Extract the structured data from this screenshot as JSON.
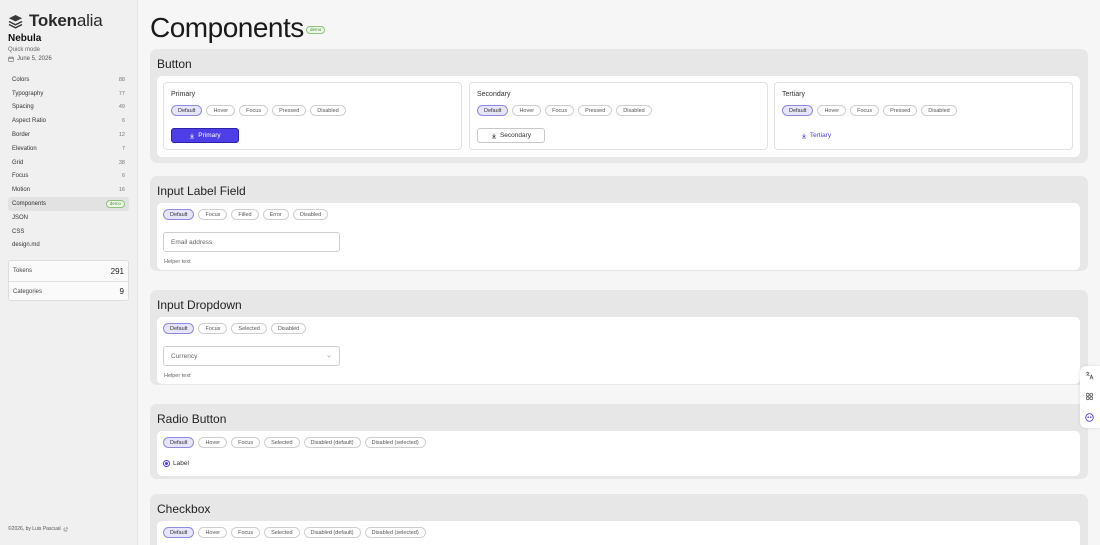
{
  "app": {
    "logo_bold": "Token",
    "logo_rest": "alia",
    "project": "Nebula",
    "mode": "Quick mode",
    "date": "June 5, 2026"
  },
  "nav": [
    {
      "label": "Colors",
      "count": "88"
    },
    {
      "label": "Typography",
      "count": "77"
    },
    {
      "label": "Spacing",
      "count": "49"
    },
    {
      "label": "Aspect Ratio",
      "count": "6"
    },
    {
      "label": "Border",
      "count": "12"
    },
    {
      "label": "Elevation",
      "count": "7"
    },
    {
      "label": "Grid",
      "count": "38"
    },
    {
      "label": "Focus",
      "count": "6"
    },
    {
      "label": "Motion",
      "count": "16"
    },
    {
      "label": "Components",
      "badge": "demo",
      "active": true
    },
    {
      "label": "JSON"
    },
    {
      "label": "CSS"
    },
    {
      "label": "design.md"
    }
  ],
  "stats": {
    "tokens_label": "Tokens",
    "tokens_value": "291",
    "categories_label": "Categories",
    "categories_value": "9"
  },
  "footer": "©2026, by Luis Pascual",
  "page": {
    "title": "Components",
    "badge": "demo"
  },
  "button_section": {
    "title": "Button",
    "primary": {
      "title": "Primary",
      "states": [
        "Default",
        "Hover",
        "Focus",
        "Pressed",
        "Disabled"
      ],
      "label": "Primary"
    },
    "secondary": {
      "title": "Secondary",
      "states": [
        "Default",
        "Hover",
        "Focus",
        "Pressed",
        "Disabled"
      ],
      "label": "Secondary"
    },
    "tertiary": {
      "title": "Tertiary",
      "states": [
        "Default",
        "Hover",
        "Focus",
        "Pressed",
        "Disabled"
      ],
      "label": "Tertiary"
    }
  },
  "input_label": {
    "title": "Input Label Field",
    "states": [
      "Default",
      "Focus",
      "Filled",
      "Error",
      "Disabled"
    ],
    "placeholder": "Email address",
    "helper": "Helper text"
  },
  "input_dropdown": {
    "title": "Input Dropdown",
    "states": [
      "Default",
      "Focus",
      "Selected",
      "Disabled"
    ],
    "placeholder": "Currency",
    "helper": "Helper text"
  },
  "radio": {
    "title": "Radio Button",
    "states": [
      "Default",
      "Hover",
      "Focus",
      "Selected",
      "Disabled (default)",
      "Disabled (selected)"
    ],
    "label": "Label"
  },
  "checkbox": {
    "title": "Checkbox",
    "states": [
      "Default",
      "Hover",
      "Focus",
      "Selected",
      "Disabled (default)",
      "Disabled (selected)"
    ]
  },
  "colors": {
    "accent": "#4d3ee8",
    "demo_badge": "#4a8a3a"
  },
  "icons": [
    "layers-logo-icon",
    "calendar-icon",
    "external-link-icon",
    "download-icon",
    "chevron-down-icon",
    "translate-icon",
    "grid-icon",
    "assistant-icon"
  ]
}
